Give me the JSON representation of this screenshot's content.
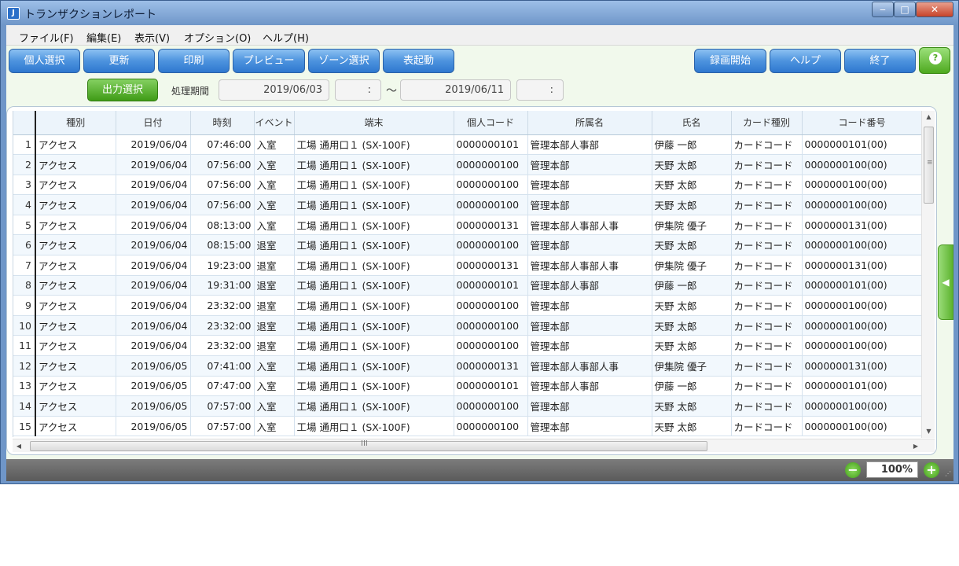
{
  "window": {
    "title": "トランザクションレポート",
    "app_icon_glyph": "J"
  },
  "window_controls": {
    "minimize": "‒",
    "maximize": "□",
    "close": "✕"
  },
  "menu": [
    {
      "label": "ファイル(F)"
    },
    {
      "label": "編集(E)"
    },
    {
      "label": "表示(V)"
    },
    {
      "label": "オプション(O)"
    },
    {
      "label": "ヘルプ(H)"
    }
  ],
  "toolbar": {
    "left": [
      {
        "label": "個人選択"
      },
      {
        "label": "更新"
      },
      {
        "label": "印刷"
      },
      {
        "label": "プレビュー"
      },
      {
        "label": "ゾーン選択"
      },
      {
        "label": "表起動"
      }
    ],
    "right": [
      {
        "label": "録画開始"
      },
      {
        "label": "ヘルプ"
      },
      {
        "label": "終了"
      }
    ],
    "help_icon_glyph": "?"
  },
  "filter": {
    "output_select_label": "出力選択",
    "period_label": "処理期間",
    "from_date": "2019/06/03",
    "from_time": ":",
    "range_separator": "～",
    "to_date": "2019/06/11",
    "to_time": ":"
  },
  "table": {
    "columns": [
      "種別",
      "日付",
      "時刻",
      "イベント",
      "端末",
      "個人コード",
      "所属名",
      "氏名",
      "カード種別",
      "コード番号"
    ],
    "rows": [
      [
        "1",
        "アクセス",
        "2019/06/04",
        "07:46:00",
        "入室",
        "工場 通用口１ (SX-100F)",
        "0000000101",
        "管理本部人事部",
        "伊藤 一郎",
        "カードコード",
        "0000000101(00)"
      ],
      [
        "2",
        "アクセス",
        "2019/06/04",
        "07:56:00",
        "入室",
        "工場 通用口１ (SX-100F)",
        "0000000100",
        "管理本部",
        "天野 太郎",
        "カードコード",
        "0000000100(00)"
      ],
      [
        "3",
        "アクセス",
        "2019/06/04",
        "07:56:00",
        "入室",
        "工場 通用口１ (SX-100F)",
        "0000000100",
        "管理本部",
        "天野 太郎",
        "カードコード",
        "0000000100(00)"
      ],
      [
        "4",
        "アクセス",
        "2019/06/04",
        "07:56:00",
        "入室",
        "工場 通用口１ (SX-100F)",
        "0000000100",
        "管理本部",
        "天野 太郎",
        "カードコード",
        "0000000100(00)"
      ],
      [
        "5",
        "アクセス",
        "2019/06/04",
        "08:13:00",
        "入室",
        "工場 通用口１ (SX-100F)",
        "0000000131",
        "管理本部人事部人事",
        "伊集院 優子",
        "カードコード",
        "0000000131(00)"
      ],
      [
        "6",
        "アクセス",
        "2019/06/04",
        "08:15:00",
        "退室",
        "工場 通用口１ (SX-100F)",
        "0000000100",
        "管理本部",
        "天野 太郎",
        "カードコード",
        "0000000100(00)"
      ],
      [
        "7",
        "アクセス",
        "2019/06/04",
        "19:23:00",
        "退室",
        "工場 通用口１ (SX-100F)",
        "0000000131",
        "管理本部人事部人事",
        "伊集院 優子",
        "カードコード",
        "0000000131(00)"
      ],
      [
        "8",
        "アクセス",
        "2019/06/04",
        "19:31:00",
        "退室",
        "工場 通用口１ (SX-100F)",
        "0000000101",
        "管理本部人事部",
        "伊藤 一郎",
        "カードコード",
        "0000000101(00)"
      ],
      [
        "9",
        "アクセス",
        "2019/06/04",
        "23:32:00",
        "退室",
        "工場 通用口１ (SX-100F)",
        "0000000100",
        "管理本部",
        "天野 太郎",
        "カードコード",
        "0000000100(00)"
      ],
      [
        "10",
        "アクセス",
        "2019/06/04",
        "23:32:00",
        "退室",
        "工場 通用口１ (SX-100F)",
        "0000000100",
        "管理本部",
        "天野 太郎",
        "カードコード",
        "0000000100(00)"
      ],
      [
        "11",
        "アクセス",
        "2019/06/04",
        "23:32:00",
        "退室",
        "工場 通用口１ (SX-100F)",
        "0000000100",
        "管理本部",
        "天野 太郎",
        "カードコード",
        "0000000100(00)"
      ],
      [
        "12",
        "アクセス",
        "2019/06/05",
        "07:41:00",
        "入室",
        "工場 通用口１ (SX-100F)",
        "0000000131",
        "管理本部人事部人事",
        "伊集院 優子",
        "カードコード",
        "0000000131(00)"
      ],
      [
        "13",
        "アクセス",
        "2019/06/05",
        "07:47:00",
        "入室",
        "工場 通用口１ (SX-100F)",
        "0000000101",
        "管理本部人事部",
        "伊藤 一郎",
        "カードコード",
        "0000000101(00)"
      ],
      [
        "14",
        "アクセス",
        "2019/06/05",
        "07:57:00",
        "入室",
        "工場 通用口１ (SX-100F)",
        "0000000100",
        "管理本部",
        "天野 太郎",
        "カードコード",
        "0000000100(00)"
      ],
      [
        "15",
        "アクセス",
        "2019/06/05",
        "07:57:00",
        "入室",
        "工場 通用口１ (SX-100F)",
        "0000000100",
        "管理本部",
        "天野 太郎",
        "カードコード",
        "0000000100(00)"
      ]
    ]
  },
  "scroll": {
    "up": "▲",
    "down": "▼",
    "left": "◀",
    "right": "▶",
    "v_grip": "≡",
    "h_grip": "III"
  },
  "side_tab_glyph": "◀",
  "zoom": {
    "value": "100%",
    "minus": "−",
    "plus": "+"
  },
  "colors": {
    "accent_blue": "#2f78cf",
    "accent_green": "#4ea91f",
    "status_gray": "#6a6a6a"
  }
}
